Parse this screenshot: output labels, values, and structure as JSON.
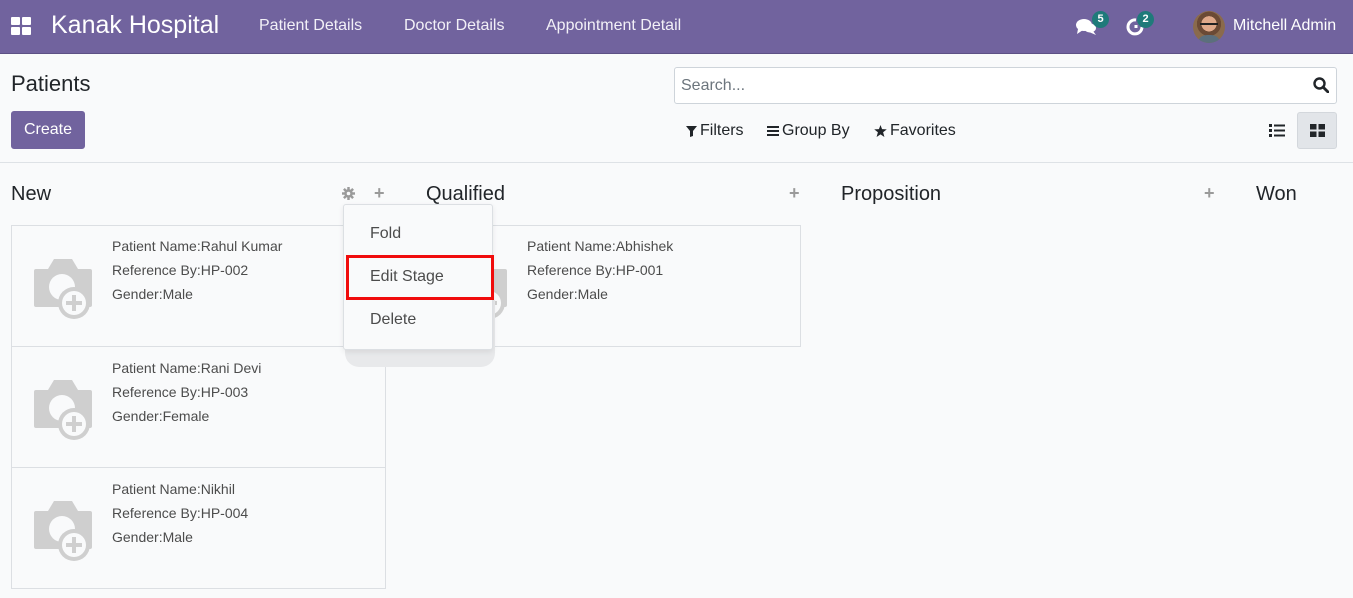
{
  "navbar": {
    "brand": "Kanak Hospital",
    "menus": [
      "Patient Details",
      "Doctor Details",
      "Appointment Detail"
    ],
    "messages_count": "5",
    "activities_count": "2",
    "user_name": "Mitchell Admin",
    "bg_color": "#71639e",
    "badge_color": "#1f7a7a"
  },
  "control_panel": {
    "title": "Patients",
    "create_label": "Create",
    "search_placeholder": "Search...",
    "search_value": "",
    "filters_label": "Filters",
    "group_by_label": "Group By",
    "favorites_label": "Favorites",
    "views": [
      {
        "name": "list-view",
        "icon": "list-icon",
        "active": false
      },
      {
        "name": "kanban-view",
        "icon": "kanban-icon",
        "active": true
      }
    ]
  },
  "kanban": {
    "columns": [
      {
        "title": "New",
        "cards": [
          {
            "name_label": "Patient Name:Rahul Kumar",
            "ref_label": "Reference By:HP-002",
            "gender_label": "Gender:Male"
          },
          {
            "name_label": "Patient Name:Rani Devi",
            "ref_label": "Reference By:HP-003",
            "gender_label": "Gender:Female"
          },
          {
            "name_label": "Patient Name:Nikhil",
            "ref_label": "Reference By:HP-004",
            "gender_label": "Gender:Male"
          }
        ]
      },
      {
        "title": "Qualified",
        "cards": [
          {
            "name_label": "Patient Name:Abhishek",
            "ref_label": "Reference By:HP-001",
            "gender_label": "Gender:Male"
          }
        ]
      },
      {
        "title": "Proposition",
        "cards": []
      },
      {
        "title": "Won",
        "cards": []
      }
    ]
  },
  "column_dropdown": {
    "items": [
      "Fold",
      "Edit Stage",
      "Delete"
    ],
    "highlighted": "Edit Stage",
    "highlight_color": "#f00c0c"
  }
}
